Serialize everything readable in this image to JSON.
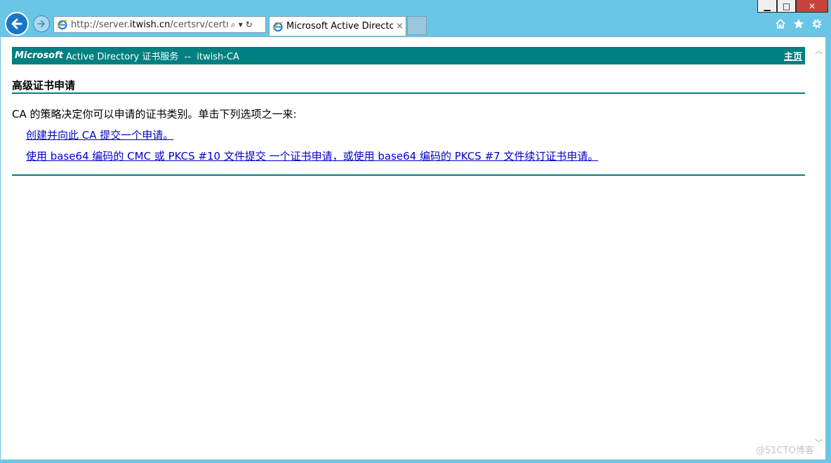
{
  "window": {
    "minimize_label": "▁",
    "maximize_label": "□",
    "close_label": "✕"
  },
  "toolbar": {
    "back_icon": "arrow-left-icon",
    "forward_icon": "arrow-right-icon",
    "address": {
      "url_prefix": "http://server.",
      "url_domain": "itwish.cn",
      "url_suffix": "/certsrv/certrqad...",
      "search_glyph": "⌕",
      "dropdown_glyph": "▾",
      "refresh_glyph": "↻"
    },
    "tab": {
      "title": "Microsoft Active Director...",
      "close_label": "×"
    }
  },
  "page": {
    "header": {
      "brand": "Microsoft",
      "title": "Active Directory 证书服务  --  itwish-CA",
      "home_link": "主页"
    },
    "heading": "高级证书申请",
    "intro": "CA 的策略决定你可以申请的证书类别。单击下列选项之一来:",
    "links": [
      "创建并向此 CA 提交一个申请。",
      "使用 base64 编码的 CMC 或 PKCS #10 文件提交 一个证书申请，或使用 base64 编码的 PKCS #7 文件续订证书申请。"
    ]
  },
  "watermark": "@51CTO博客",
  "colors": {
    "chrome": "#6ac6e6",
    "header_bar": "#008080",
    "link": "#0000cc",
    "close_button": "#c7423a"
  }
}
